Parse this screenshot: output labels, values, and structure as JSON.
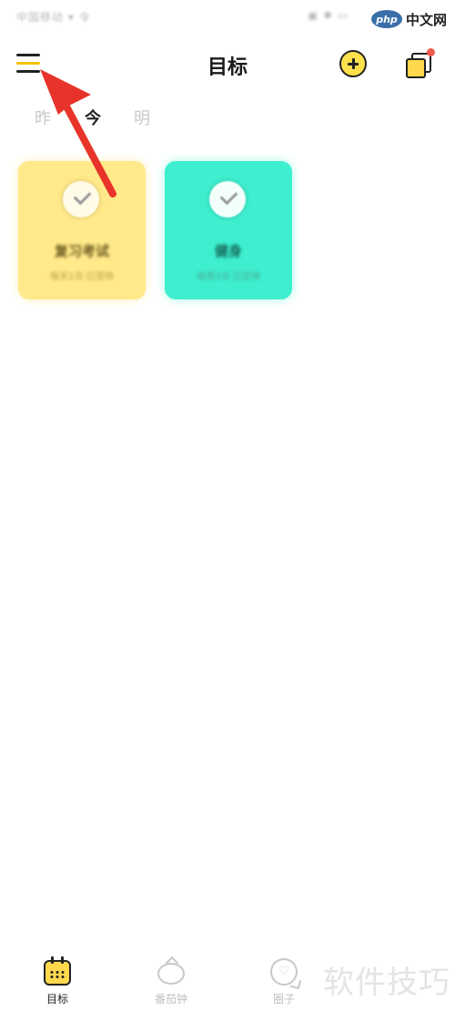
{
  "status_bar": {
    "left_text": "中国移动 ▾ 令",
    "right_text": "▣ ✱ ▭"
  },
  "watermark_top": {
    "logo": "php",
    "text": "中文网"
  },
  "header": {
    "title": "目标"
  },
  "day_tabs": [
    "昨",
    "今",
    "明"
  ],
  "goals": [
    {
      "name": "复习考试",
      "subtitle": "每天1次·已坚持",
      "color": "#ffe98a"
    },
    {
      "name": "健身",
      "subtitle": "每周3次·已坚持",
      "color": "#3eeece"
    }
  ],
  "annotation": {
    "arrow_color": "#e8332a"
  },
  "bottom_nav": [
    {
      "label": "目标",
      "icon": "calendar-icon"
    },
    {
      "label": "番茄钟",
      "icon": "tomato-icon"
    },
    {
      "label": "圈子",
      "icon": "heart-chat-icon"
    }
  ],
  "watermark_bottom": "软件技巧",
  "colors": {
    "accent_yellow": "#ffd84d",
    "badge_red": "#f05a4f"
  }
}
